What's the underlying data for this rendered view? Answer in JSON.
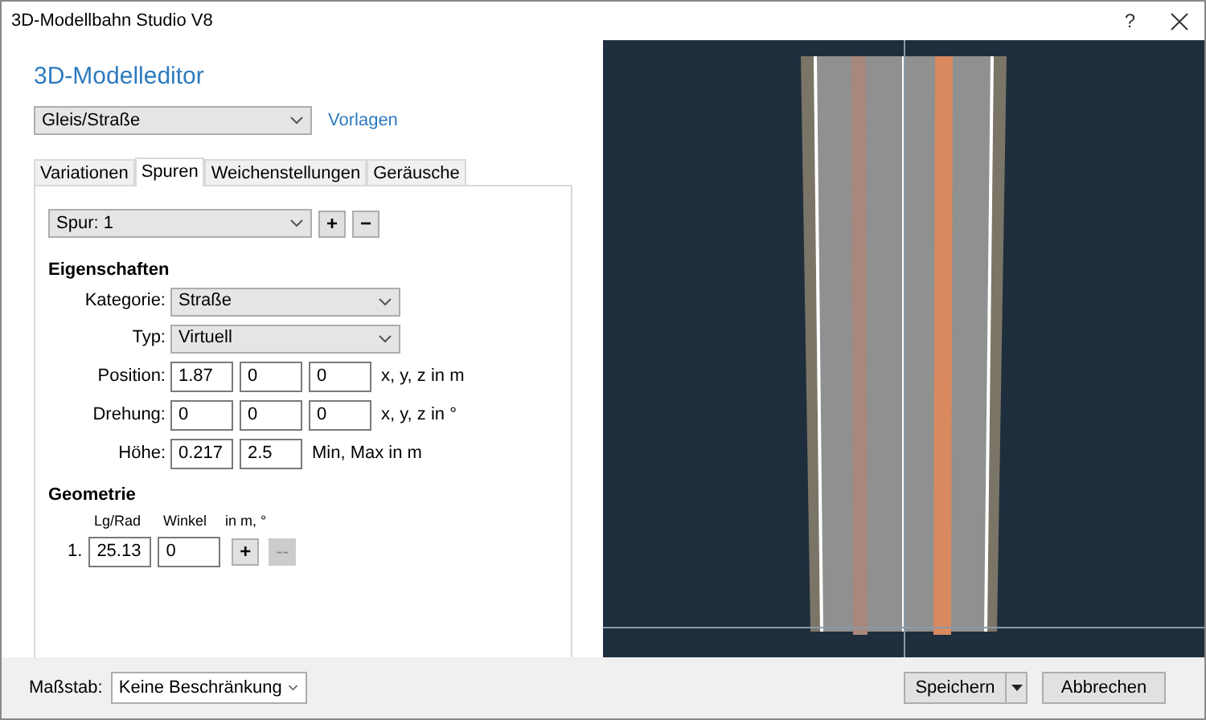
{
  "window": {
    "title": "3D-Modellbahn Studio V8",
    "help": "?"
  },
  "editor": {
    "heading": "3D-Modelleditor",
    "model_select": "Gleis/Straße",
    "templates_link": "Vorlagen"
  },
  "tabs": [
    {
      "label": "Variationen",
      "selected": false
    },
    {
      "label": "Spuren",
      "selected": true
    },
    {
      "label": "Weichenstellungen",
      "selected": false
    },
    {
      "label": "Geräusche",
      "selected": false
    }
  ],
  "track": {
    "select": "Spur: 1",
    "add": "+",
    "remove": "−"
  },
  "properties": {
    "heading": "Eigenschaften",
    "rows": [
      {
        "kind": "select",
        "label": "Kategorie:",
        "value": "Straße"
      },
      {
        "kind": "select",
        "label": "Typ:",
        "value": "Virtuell"
      },
      {
        "kind": "inputs",
        "label": "Position:",
        "values": [
          "1.87",
          "0",
          "0"
        ],
        "unit": "x, y, z in m"
      },
      {
        "kind": "inputs",
        "label": "Drehung:",
        "values": [
          "0",
          "0",
          "0"
        ],
        "unit": "x, y, z in °"
      },
      {
        "kind": "inputs",
        "label": "Höhe:",
        "values": [
          "0.217",
          "2.5"
        ],
        "unit": "Min, Max in m"
      }
    ]
  },
  "geometry": {
    "heading": "Geometrie",
    "columns": [
      "Lg/Rad",
      "Winkel",
      "in m, °"
    ],
    "rows": [
      {
        "index": "1.",
        "length": "25.13",
        "angle": "0"
      }
    ],
    "add": {
      "label": "+",
      "disabled": false
    },
    "remove": {
      "label": "--",
      "disabled": true
    }
  },
  "footer": {
    "scale_label": "Maßstab:",
    "scale_value": "Keine Beschränkung",
    "save": "Speichern",
    "cancel": "Abbrechen"
  }
}
